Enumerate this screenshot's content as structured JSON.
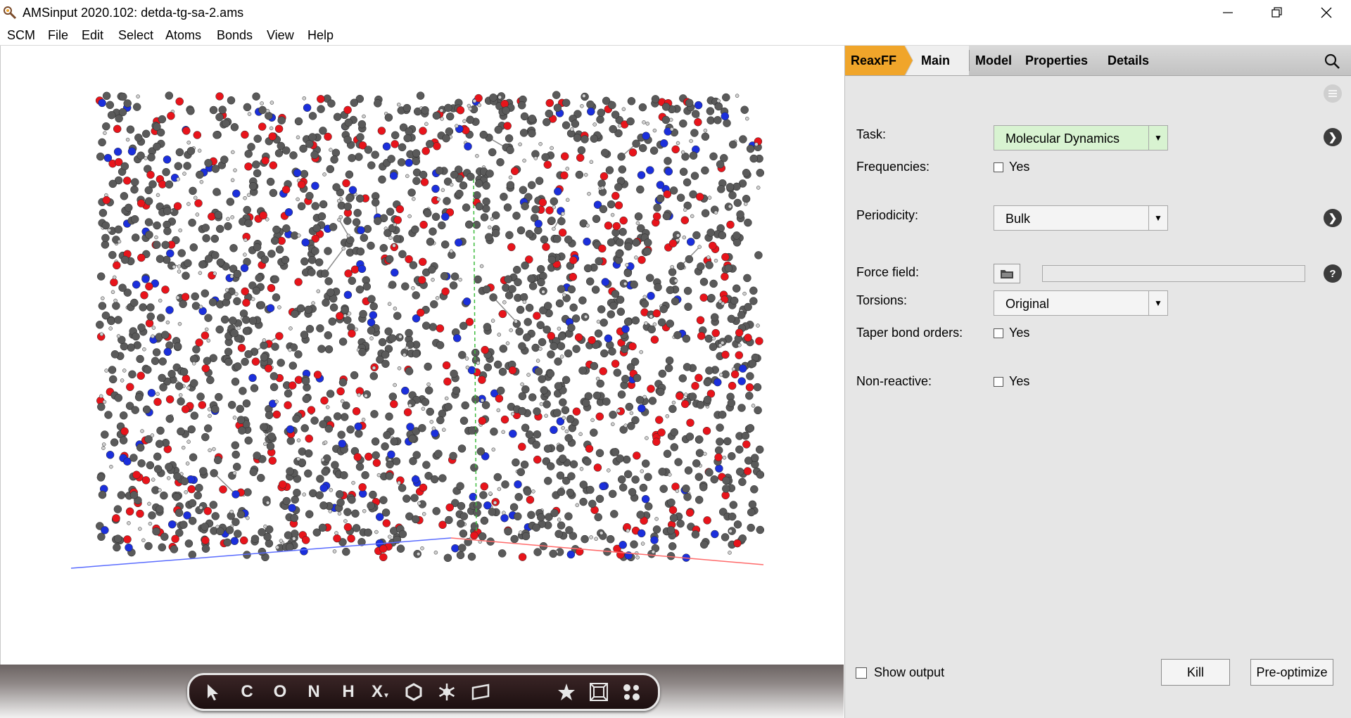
{
  "window": {
    "title": "AMSinput 2020.102: detda-tg-sa-2.ams",
    "icons": [
      "app-icon",
      "minimize-icon",
      "restore-icon",
      "close-icon"
    ]
  },
  "menubar": {
    "items": [
      "SCM",
      "File",
      "Edit",
      "Select",
      "Atoms",
      "Bonds",
      "View",
      "Help"
    ]
  },
  "viewport": {
    "atom_colors": {
      "carbon": "#5a5a5a",
      "oxygen": "#e8141b",
      "nitrogen": "#1b2fdc",
      "hydrogen": "#d0d0d0"
    },
    "axis_colors": {
      "x": "#ff6a6a",
      "y": "#3dbb3d",
      "z": "#5a6cff"
    }
  },
  "toolbar": {
    "tools": [
      {
        "icon": "select-arrow-icon",
        "label": ""
      },
      {
        "icon": "carbon-icon",
        "label": "C"
      },
      {
        "icon": "oxygen-icon",
        "label": "O"
      },
      {
        "icon": "nitrogen-icon",
        "label": "N"
      },
      {
        "icon": "hydrogen-icon",
        "label": "H"
      },
      {
        "icon": "other-element-icon",
        "label": "X"
      },
      {
        "icon": "ring-icon",
        "label": ""
      },
      {
        "icon": "freeze-icon",
        "label": ""
      },
      {
        "icon": "plane-icon",
        "label": ""
      },
      {
        "icon": "star-icon",
        "label": ""
      },
      {
        "icon": "periodic-box-icon",
        "label": ""
      },
      {
        "icon": "molecules-icon",
        "label": ""
      }
    ]
  },
  "panel": {
    "breadcrumb": {
      "engine": "ReaxFF",
      "current": "Main"
    },
    "tabs": [
      "Model",
      "Properties",
      "Details"
    ],
    "accent_color": "#f0a52a",
    "fields": {
      "task": {
        "label": "Task:",
        "value": "Molecular Dynamics"
      },
      "frequencies": {
        "label": "Frequencies:",
        "option": "Yes",
        "checked": false
      },
      "periodicity": {
        "label": "Periodicity:",
        "value": "Bulk"
      },
      "force_field": {
        "label": "Force field:",
        "value": ""
      },
      "torsions": {
        "label": "Torsions:",
        "value": "Original"
      },
      "taper": {
        "label": "Taper bond orders:",
        "option": "Yes",
        "checked": false
      },
      "nonreactive": {
        "label": "Non-reactive:",
        "option": "Yes",
        "checked": false
      }
    },
    "help_glyph": "?",
    "show_output": {
      "label": "Show output",
      "checked": false
    },
    "buttons": {
      "kill": "Kill",
      "preoptimize": "Pre-optimize"
    }
  }
}
